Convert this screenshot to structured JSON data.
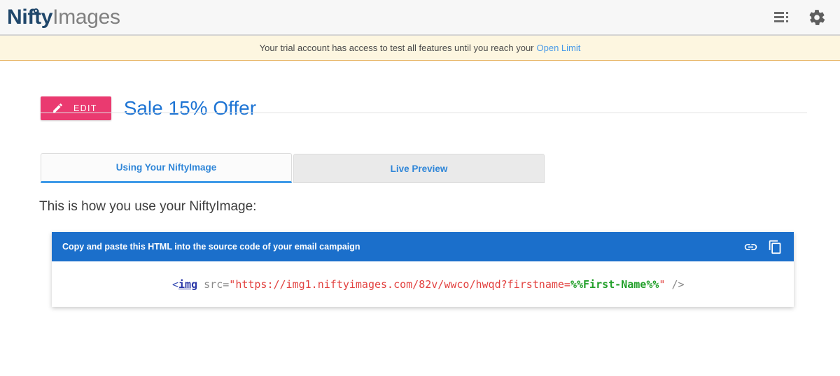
{
  "header": {
    "logo_primary": "Nifty",
    "logo_secondary": "Images",
    "list_icon": "list-menu-icon",
    "gear_icon": "gear-icon"
  },
  "banner": {
    "text": "Your trial account has access to test all features until you reach your",
    "link_label": "Open Limit",
    "link_color": "#4a9ae8",
    "background": "#fdf6e0"
  },
  "title_row": {
    "edit_label": "EDIT",
    "edit_icon": "pencil-icon",
    "edit_color": "#ea3a70",
    "title": "Sale 15% Offer",
    "title_color": "#1d74d4"
  },
  "tabs": [
    {
      "label": "Using Your NiftyImage",
      "active": true
    },
    {
      "label": "Live Preview",
      "active": false
    }
  ],
  "main": {
    "howto_heading": "This is how you use your NiftyImage:"
  },
  "code_panel": {
    "header_label": "Copy and paste this HTML into the source code of your email campaign",
    "header_color": "#1b6fcb",
    "link_icon": "link-icon",
    "copy_icon": "copy-icon",
    "code": {
      "open_bracket": "<",
      "tag": "img",
      "space": " ",
      "attr": "src",
      "equals": "=",
      "quote_open": "\"",
      "url": "https://img1.niftyimages.com/82v/wwco/hwqd?firstname=",
      "merge_tag": "%%First-Name%%",
      "quote_close": "\"",
      "close": " />",
      "full": "<img src=\"https://img1.niftyimages.com/82v/wwco/hwqd?firstname=%%First-Name%%\" />"
    }
  }
}
